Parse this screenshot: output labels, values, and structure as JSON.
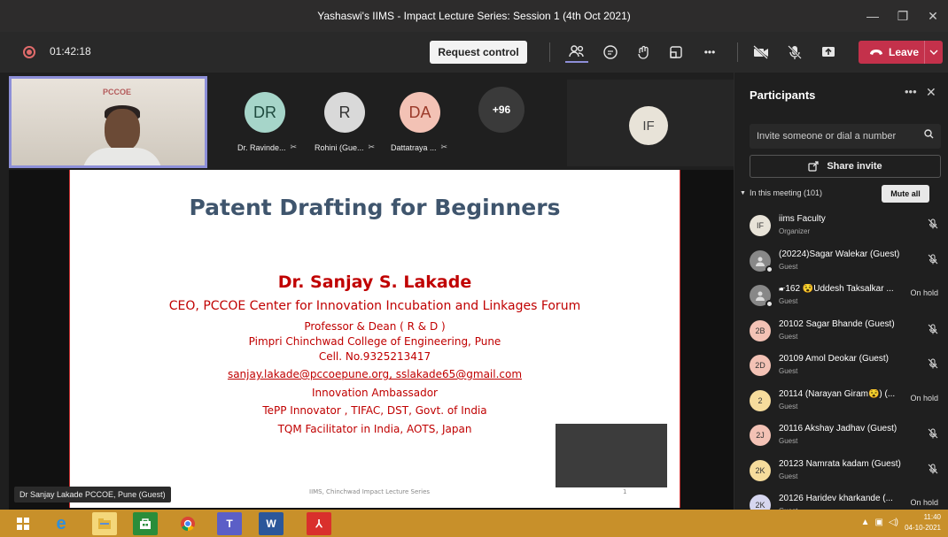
{
  "window": {
    "title": "Yashaswi's IIMS - Impact Lecture Series: Session 1 (4th Oct 2021)",
    "controls": [
      "—",
      "❐",
      "✕"
    ]
  },
  "toolbar": {
    "timer": "01:42:18",
    "request_control": "Request control",
    "more": "•••",
    "leave": "Leave"
  },
  "strip": {
    "participants": [
      {
        "initials": "DR",
        "name": "Dr. Ravinde...",
        "color": "#a6d5c9"
      },
      {
        "initials": "R",
        "name": "Rohini (Gue...",
        "color": "#d9d9d9"
      },
      {
        "initials": "DA",
        "name": "Dattatraya ...",
        "color": "#f3c2b5"
      }
    ],
    "overflow": "+96",
    "extra_initials": "IF",
    "self_logo": "PCCOE"
  },
  "slide": {
    "title": "Patent Drafting for Beginners",
    "name": "Dr. Sanjay S. Lakade",
    "ceo": "CEO, PCCOE Center for Innovation Incubation and Linkages Forum",
    "lines": [
      "Professor & Dean ( R & D )",
      "Pimpri Chinchwad College of Engineering, Pune",
      "Cell. No.9325213417",
      "sanjay.lakade@pccoepune.org,  sslakade65@gmail.com",
      "Innovation Ambassador",
      "TePP Innovator , TIFAC, DST, Govt. of India",
      "TQM Facilitator in India, AOTS, Japan"
    ],
    "footer": "IIMS, Chinchwad Impact Lecture Series",
    "page": "1"
  },
  "presenter_label": "Dr Sanjay Lakade PCCOE, Pune (Guest)",
  "panel": {
    "title": "Participants",
    "invite_placeholder": "Invite someone or dial a number",
    "share_invite": "Share invite",
    "meeting_header": "In this meeting (101)",
    "mute_all": "Mute all",
    "participants": [
      {
        "initials": "IF",
        "name": "iims Faculty",
        "role": "Organizer",
        "status": "mic-off",
        "avatar": "#e8e3d8",
        "dot": "#c4314b"
      },
      {
        "initials": "",
        "name": "(20224)Sagar Walekar (Guest)",
        "role": "Guest",
        "status": "mic-off",
        "avatar": "#888888",
        "dot": "#e6e6e6"
      },
      {
        "initials": "",
        "name": "🖝162 😵Uddesh Taksalkar ...",
        "role": "Guest",
        "status": "On hold",
        "avatar": "#888888",
        "dot": "#e6e6e6"
      },
      {
        "initials": "2B",
        "name": "20102 Sagar Bhande (Guest)",
        "role": "Guest",
        "status": "mic-off",
        "avatar": "#f3c2b5",
        "dot": "#e6e6e6"
      },
      {
        "initials": "2D",
        "name": "20109 Amol Deokar (Guest)",
        "role": "Guest",
        "status": "mic-off",
        "avatar": "#f3c2b5",
        "dot": "#e6e6e6"
      },
      {
        "initials": "2",
        "name": "20114 (Narayan Giram😵) (...",
        "role": "Guest",
        "status": "On hold",
        "avatar": "#f6dc9c",
        "dot": "#e6e6e6"
      },
      {
        "initials": "2J",
        "name": "20116 Akshay Jadhav (Guest)",
        "role": "Guest",
        "status": "mic-off",
        "avatar": "#f3c2b5",
        "dot": "#e6e6e6"
      },
      {
        "initials": "2K",
        "name": "20123 Namrata kadam (Guest)",
        "role": "Guest",
        "status": "mic-off",
        "avatar": "#f6dc9c",
        "dot": "#e6e6e6"
      },
      {
        "initials": "2K",
        "name": "20126 Haridev kharkande (...",
        "role": "Guest",
        "status": "On hold",
        "avatar": "#d6d6ef",
        "dot": "#e6e6e6"
      }
    ]
  },
  "taskbar": {
    "time": "11:40",
    "date": "04-10-2021"
  }
}
